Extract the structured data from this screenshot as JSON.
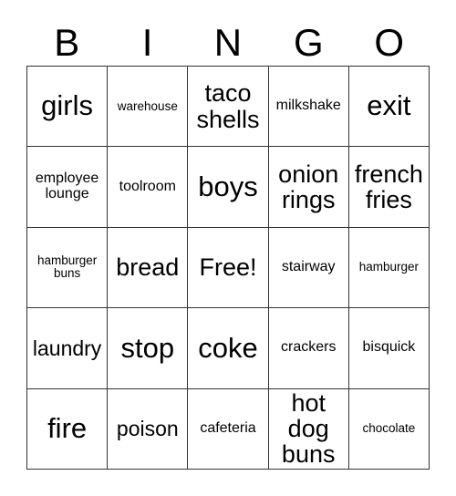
{
  "card": {
    "header_letters": [
      "B",
      "I",
      "N",
      "G",
      "O"
    ],
    "rows": [
      [
        {
          "label": "girls",
          "size": "s-xl"
        },
        {
          "label": "warehouse",
          "size": "s-xs"
        },
        {
          "label": "taco\nshells",
          "size": "s-lg"
        },
        {
          "label": "milkshake",
          "size": "s-sm"
        },
        {
          "label": "exit",
          "size": "s-xl"
        }
      ],
      [
        {
          "label": "employee\nlounge",
          "size": "s-sm"
        },
        {
          "label": "toolroom",
          "size": "s-sm"
        },
        {
          "label": "boys",
          "size": "s-xl"
        },
        {
          "label": "onion\nrings",
          "size": "s-lg"
        },
        {
          "label": "french\nfries",
          "size": "s-lg"
        }
      ],
      [
        {
          "label": "hamburger\nbuns",
          "size": "s-xs"
        },
        {
          "label": "bread",
          "size": "s-lg"
        },
        {
          "label": "Free!",
          "size": "s-lg"
        },
        {
          "label": "stairway",
          "size": "s-sm"
        },
        {
          "label": "hamburger",
          "size": "s-xs"
        }
      ],
      [
        {
          "label": "laundry",
          "size": "s-md"
        },
        {
          "label": "stop",
          "size": "s-xl"
        },
        {
          "label": "coke",
          "size": "s-xl"
        },
        {
          "label": "crackers",
          "size": "s-sm"
        },
        {
          "label": "bisquick",
          "size": "s-sm"
        }
      ],
      [
        {
          "label": "fire",
          "size": "s-xl"
        },
        {
          "label": "poison",
          "size": "s-md"
        },
        {
          "label": "cafeteria",
          "size": "s-sm"
        },
        {
          "label": "hot dog\nbuns",
          "size": "s-lg"
        },
        {
          "label": "chocolate",
          "size": "s-xs"
        }
      ]
    ],
    "colors": {
      "border": "#333333",
      "background": "#ffffff",
      "text": "#000000"
    }
  }
}
